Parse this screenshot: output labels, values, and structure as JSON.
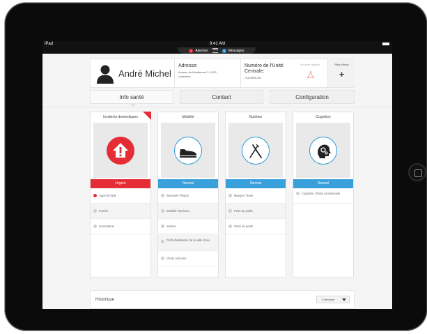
{
  "statusbar": {
    "device": "iPad",
    "time": "9:41 AM"
  },
  "notifications": {
    "alarms_count": "1",
    "alarms_label": "Alarmes",
    "messages_count": "0",
    "messages_label": "Messages"
  },
  "header": {
    "name": "André Michel",
    "address_title": "Adresse:",
    "address_value": "Avenue de Montbenon 3, 1003 Lausanne",
    "number_title": "Numéro de l'Unité Centrale:",
    "number_value": "+4178691767",
    "send_report_label": "Envoyer rapport",
    "more_info_label": "Plus d'infos",
    "more_info_symbol": "+"
  },
  "tabs": [
    {
      "label": "Info santé"
    },
    {
      "label": "Contact"
    },
    {
      "label": "Configuration"
    }
  ],
  "cards": [
    {
      "title": "Incidents domestiques",
      "icon": "house-alert-icon",
      "status": "Urgent",
      "items": [
        {
          "label": "Appel à l'aide"
        },
        {
          "label": "Fumée"
        },
        {
          "label": "Innondation"
        }
      ]
    },
    {
      "title": "Mobilité",
      "icon": "shoe-icon",
      "status": "Normal",
      "items": [
        {
          "label": "Sommeil / Repos"
        },
        {
          "label": "Mobilité interieure"
        },
        {
          "label": "Sorties"
        },
        {
          "label": "Profil d'utilisation de la salle d'eau"
        },
        {
          "label": "Chute nocturne"
        }
      ]
    },
    {
      "title": "Nutrition",
      "icon": "fork-knife-icon",
      "status": "Normal",
      "items": [
        {
          "label": "Manger / Boire"
        },
        {
          "label": "Prise de poids"
        },
        {
          "label": "Perte de poids"
        }
      ]
    },
    {
      "title": "Cognition",
      "icon": "head-gears-icon",
      "status": "Normal",
      "items": [
        {
          "label": "Cognition / Etats confusionels"
        }
      ]
    }
  ],
  "history": {
    "label": "Historique",
    "period": "1 Semaine"
  },
  "colors": {
    "urgent": "#e52d36",
    "normal": "#3aa0dc"
  }
}
